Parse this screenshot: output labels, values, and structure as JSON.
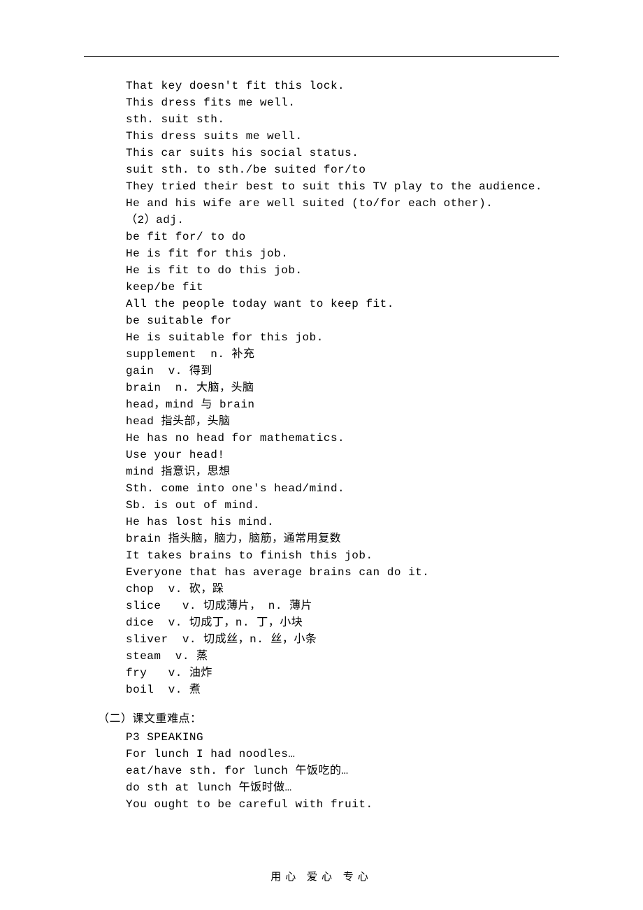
{
  "lines": [
    "That key doesn't fit this lock.",
    "This dress fits me well.",
    "sth. suit sth.",
    "This dress suits me well.",
    "This car suits his social status.",
    "suit sth. to sth./be suited for/to",
    "They tried their best to suit this TV play to the audience.",
    "He and his wife are well suited (to/for each other).",
    "（2）adj.",
    "be fit for/ to do",
    "He is fit for this job.",
    "He is fit to do this job.",
    "keep/be fit",
    "All the people today want to keep fit.",
    "be suitable for",
    "He is suitable for this job.",
    "supplement  n. 补充",
    "gain  v. 得到",
    "brain  n. 大脑，头脑",
    "head，mind 与 brain",
    "head 指头部，头脑",
    "He has no head for mathematics.",
    "Use your head!",
    "mind 指意识，思想",
    "Sth. come into one's head/mind.",
    "Sb. is out of mind.",
    "He has lost his mind.",
    "brain 指头脑，脑力，脑筋，通常用复数",
    "It takes brains to finish this job.",
    "Everyone that has average brains can do it.",
    "chop  v. 砍，跺",
    "slice   v. 切成薄片， n. 薄片",
    "dice  v. 切成丁，n. 丁，小块",
    "sliver  v. 切成丝，n. 丝，小条",
    "steam  v. 蒸",
    "fry   v. 油炸",
    "boil  v. 煮"
  ],
  "section2_heading": "（二）课文重难点：",
  "section2_lines": [
    "P3 SPEAKING",
    "For lunch I had noodles…",
    "eat/have sth. for lunch 午饭吃的…",
    "do sth at lunch 午饭时做…",
    "You ought to be careful with fruit."
  ],
  "footer": "用心   爱心   专心"
}
